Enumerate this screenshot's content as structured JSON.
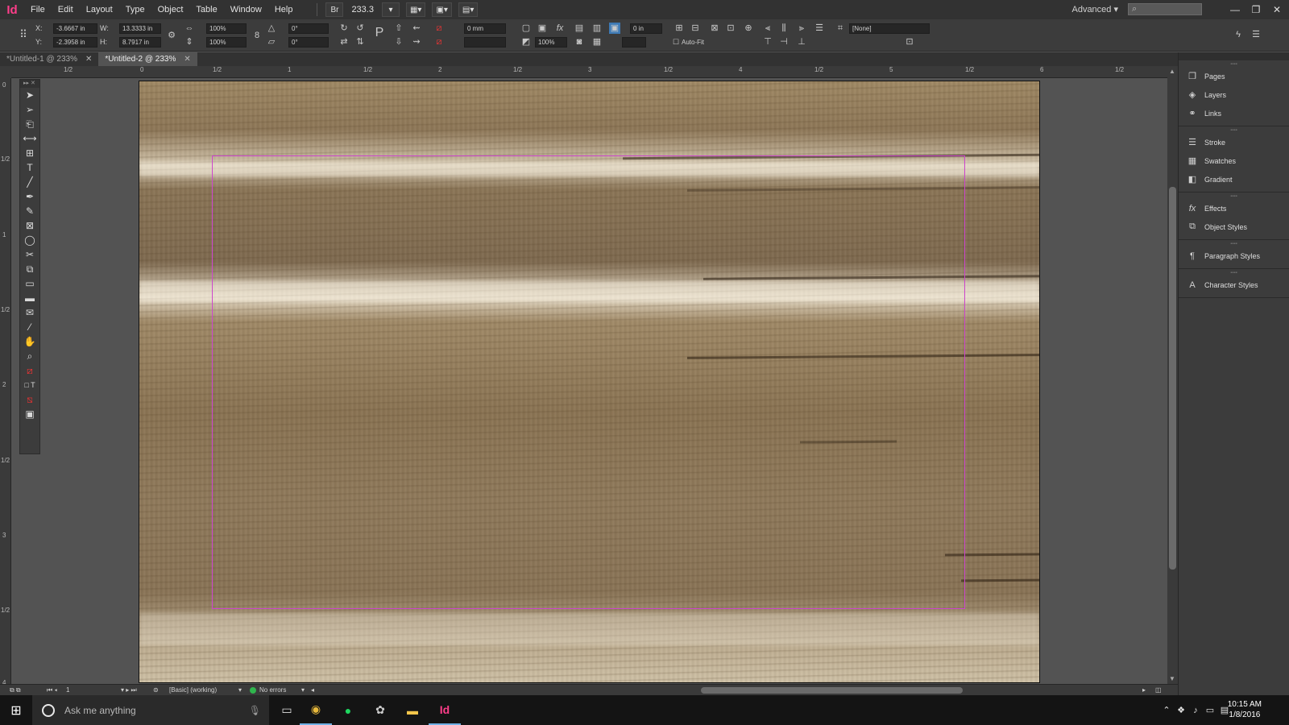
{
  "app": {
    "logo": "Id",
    "menus": [
      "File",
      "Edit",
      "Layout",
      "Type",
      "Object",
      "Table",
      "Window",
      "Help"
    ],
    "bridge_label": "Br",
    "zoom": "233.3",
    "workspace": "Advanced",
    "search_placeholder": ""
  },
  "control": {
    "x_label": "X:",
    "x_value": "-3.6667 in",
    "y_label": "Y:",
    "y_value": "-2.3958 in",
    "w_label": "W:",
    "w_value": "13.3333 in",
    "h_label": "H:",
    "h_value": "8.7917 in",
    "scale_x": "100%",
    "scale_y": "100%",
    "rotate": "0°",
    "shear": "0°",
    "stroke_weight": "0 mm",
    "opacity": "100%",
    "offset": "0 in",
    "style_none": "[None]",
    "auto_fit": "Auto-Fit"
  },
  "tabs": [
    {
      "label": "*Untitled-1 @ 233%",
      "active": false
    },
    {
      "label": "*Untitled-2 @ 233%",
      "active": true
    }
  ],
  "ruler": {
    "h_labels": [
      "1/2",
      "0",
      "1/2",
      "1",
      "1/2",
      "2",
      "1/2",
      "3",
      "1/2",
      "4",
      "1/2",
      "5",
      "1/2",
      "6",
      "1/2"
    ],
    "v_labels": [
      "0",
      "1/2",
      "1",
      "1/2",
      "2",
      "1/2",
      "3",
      "1/2",
      "4"
    ]
  },
  "tools": [
    "selection",
    "direct-selection",
    "page",
    "gap",
    "content-collector",
    "type",
    "line",
    "pen",
    "pencil",
    "rectangle-frame",
    "ellipse",
    "scissors",
    "free-transform",
    "gradient-swatch",
    "gradient-feather",
    "note",
    "eyedropper",
    "hand",
    "zoom",
    "fill-stroke",
    "formatting",
    "apply-none",
    "screen-mode"
  ],
  "panels": [
    {
      "group": [
        {
          "label": "Pages",
          "icon": "pages-icon"
        },
        {
          "label": "Layers",
          "icon": "layers-icon"
        },
        {
          "label": "Links",
          "icon": "links-icon"
        }
      ]
    },
    {
      "group": [
        {
          "label": "Stroke",
          "icon": "stroke-icon"
        },
        {
          "label": "Swatches",
          "icon": "swatches-icon"
        },
        {
          "label": "Gradient",
          "icon": "gradient-icon"
        }
      ]
    },
    {
      "group": [
        {
          "label": "Effects",
          "icon": "effects-icon"
        },
        {
          "label": "Object Styles",
          "icon": "object-styles-icon"
        }
      ]
    },
    {
      "group": [
        {
          "label": "Paragraph Styles",
          "icon": "paragraph-styles-icon"
        }
      ]
    },
    {
      "group": [
        {
          "label": "Character Styles",
          "icon": "character-styles-icon"
        }
      ]
    }
  ],
  "status": {
    "page_number": "1",
    "preflight_profile": "[Basic] (working)",
    "errors": "No errors"
  },
  "taskbar": {
    "search_placeholder": "Ask me anything",
    "time": "10:15 AM",
    "date": "1/8/2016"
  },
  "colors": {
    "accent_indesign": "#ff3e8a",
    "margin_guide": "#cc44cc",
    "preflight_ok": "#2fb54d"
  }
}
